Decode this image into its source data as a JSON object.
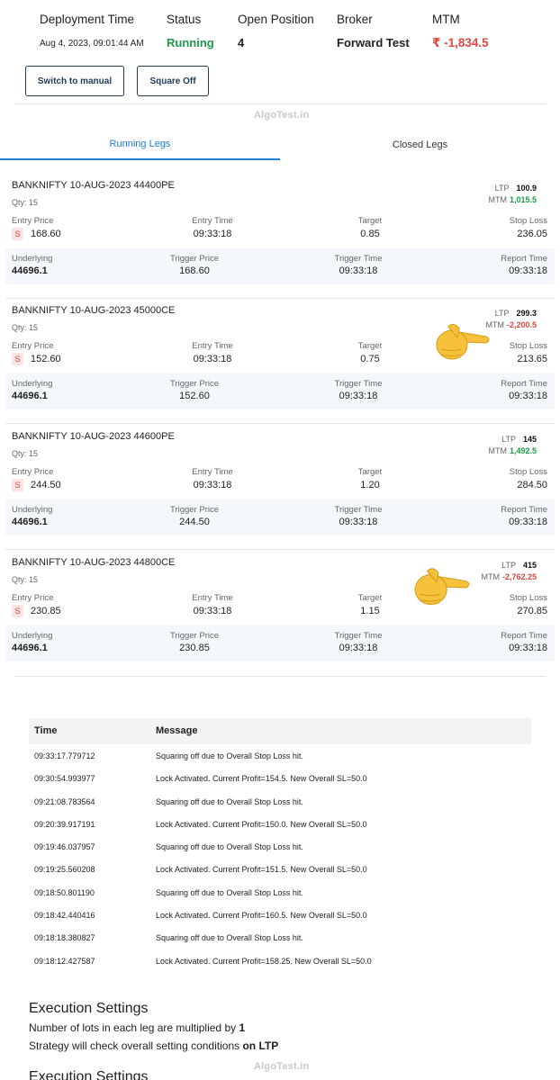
{
  "summary": {
    "deployment_time_label": "Deployment Time",
    "deployment_time_value": "Aug 4, 2023, 09:01:44 AM",
    "status_label": "Status",
    "status_value": "Running",
    "open_position_label": "Open Position",
    "open_position_value": "4",
    "broker_label": "Broker",
    "broker_value": "Forward Test",
    "mtm_label": "MTM",
    "mtm_value": "₹ -1,834.5"
  },
  "buttons": {
    "switch_manual": "Switch to manual",
    "square_off": "Square Off"
  },
  "watermark": "AlgoTest.in",
  "tabs": {
    "running": "Running Legs",
    "closed": "Closed Legs"
  },
  "leg_labels": {
    "qty_prefix": "Qty: ",
    "ltp": "LTP",
    "mtm": "MTM",
    "entry_price": "Entry Price",
    "entry_time": "Entry Time",
    "target": "Target",
    "stop_loss": "Stop Loss",
    "underlying": "Underlying",
    "trigger_price": "Trigger Price",
    "trigger_time": "Trigger Time",
    "report_time": "Report Time",
    "side": "S"
  },
  "legs": [
    {
      "title": "BANKNIFTY 10-AUG-2023 44400PE",
      "qty": "Qty: 15",
      "ltp": "100.9",
      "mtm": "1,015.5",
      "mtm_sign": "pos",
      "entry_price": "168.60",
      "entry_time": "09:33:18",
      "target": "0.85",
      "stop_loss": "236.05",
      "underlying": "44696.1",
      "trigger_price": "168.60",
      "trigger_time": "09:33:18",
      "report_time": "09:33:18"
    },
    {
      "title": "BANKNIFTY 10-AUG-2023 45000CE",
      "qty": "Qty: 15",
      "ltp": "299.3",
      "mtm": "-2,200.5",
      "mtm_sign": "neg",
      "entry_price": "152.60",
      "entry_time": "09:33:18",
      "target": "0.75",
      "stop_loss": "213.65",
      "underlying": "44696.1",
      "trigger_price": "152.60",
      "trigger_time": "09:33:18",
      "report_time": "09:33:18"
    },
    {
      "title": "BANKNIFTY 10-AUG-2023 44600PE",
      "qty": "Qty: 15",
      "ltp": "145",
      "mtm": "1,492.5",
      "mtm_sign": "pos",
      "entry_price": "244.50",
      "entry_time": "09:33:18",
      "target": "1.20",
      "stop_loss": "284.50",
      "underlying": "44696.1",
      "trigger_price": "244.50",
      "trigger_time": "09:33:18",
      "report_time": "09:33:18"
    },
    {
      "title": "BANKNIFTY 10-AUG-2023 44800CE",
      "qty": "Qty: 15",
      "ltp": "415",
      "mtm": "-2,762.25",
      "mtm_sign": "neg",
      "entry_price": "230.85",
      "entry_time": "09:33:18",
      "target": "1.15",
      "stop_loss": "270.85",
      "underlying": "44696.1",
      "trigger_price": "230.85",
      "trigger_time": "09:33:18",
      "report_time": "09:33:18"
    }
  ],
  "log": {
    "headers": [
      "Time",
      "Message"
    ],
    "rows": [
      [
        "09:33:17.779712",
        "Squaring off due to Overall Stop Loss hit."
      ],
      [
        "09:30:54.993977",
        "Lock Activated. Current Profit=154.5. New Overall SL=50.0"
      ],
      [
        "09:21:08.783564",
        "Squaring off due to Overall Stop Loss hit."
      ],
      [
        "09:20:39.917191",
        "Lock Activated. Current Profit=150.0. New Overall SL=50.0"
      ],
      [
        "09:19:46.037957",
        "Squaring off due to Overall Stop Loss hit."
      ],
      [
        "09:19:25.560208",
        "Lock Activated. Current Profit=151.5. New Overall SL=50.0"
      ],
      [
        "09:18:50.801190",
        "Squaring off due to Overall Stop Loss hit."
      ],
      [
        "09:18:42.440416",
        "Lock Activated. Current Profit=160.5. New Overall SL=50.0"
      ],
      [
        "09:18:18.380827",
        "Squaring off due to Overall Stop Loss hit."
      ],
      [
        "09:18:12.427587",
        "Lock Activated. Current Profit=158.25. New Overall SL=50.0"
      ]
    ]
  },
  "execution": {
    "title": "Execution Settings",
    "lots_text": "Number of lots in each leg are multiplied by ",
    "lots_value": "1",
    "check_text": "Strategy will check overall setting conditions ",
    "check_value": "on LTP",
    "cut_title": "Execution Settings"
  },
  "colors": {
    "accent": "#1b7fd6",
    "profit": "#1e9a4a",
    "loss": "#e0473e",
    "button_border": "#1d3b57"
  }
}
